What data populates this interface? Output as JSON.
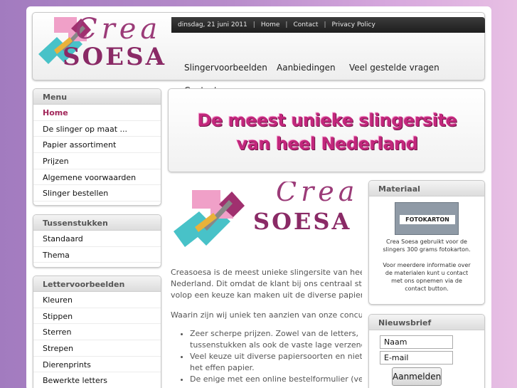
{
  "header": {
    "logo_top": "Crea",
    "logo_bottom": "SOESA",
    "date": "dinsdag, 21 juni 2011",
    "links": [
      "Home",
      "Contact",
      "Privacy Policy"
    ],
    "nav": [
      "Slingervoorbeelden",
      "Aanbiedingen",
      "Veel gestelde vragen",
      "Contact"
    ]
  },
  "banner": {
    "line1": "De meest unieke slingersite",
    "line2": "van heel Nederland"
  },
  "sidebar": {
    "menu": {
      "title": "Menu",
      "items": [
        "Home",
        "De slinger op maat ...",
        "Papier assortiment",
        "Prijzen",
        "Algemene voorwaarden",
        "Slinger bestellen"
      ],
      "active": "Home"
    },
    "tussenstukken": {
      "title": "Tussenstukken",
      "items": [
        "Standaard",
        "Thema"
      ]
    },
    "lettervoorbeelden": {
      "title": "Lettervoorbeelden",
      "items": [
        "Kleuren",
        "Stippen",
        "Sterren",
        "Strepen",
        "Dierenprints",
        "Bewerkte letters"
      ]
    }
  },
  "content": {
    "logo_top": "Crea",
    "logo_bottom": "SOESA",
    "para1_l1": "Creasoesa is de meest unieke slingersite van heel",
    "para1_l2": "Nederland. Dit omdat de klant bij ons centraal staat en",
    "para1_l3": "volop een keuze kan maken uit de diverse papiersoorten",
    "para2": "Waarin zijn wij uniek ten aanzien van onze concurrenten",
    "bullet1_l1": "Zeer scherpe prijzen. Zowel van de letters,",
    "bullet1_l2": "tussenstukken als ook de vaste lage verzendkosten",
    "bullet2_l1": "Veel keuze uit diverse papiersoorten en niet alleen",
    "bullet2_l2": "het effen papier.",
    "bullet3_l1": "De enige met een online bestelformulier (verwerkt"
  },
  "materiaal": {
    "title": "Materiaal",
    "product_label": "FOTOKARTON",
    "text_l1": "Crea Soesa gebruikt voor de",
    "text_l2": "slingers 300 grams fotokarton.",
    "text_l3": "Voor meerdere informatie over",
    "text_l4": "de materialen kunt u contact",
    "text_l5": "met ons opnemen via de",
    "text_l6": "contact button."
  },
  "nieuwsbrief": {
    "title": "Nieuwsbrief",
    "name_value": "Naam",
    "email_value": "E-mail",
    "submit": "Aanmelden"
  },
  "colors": {
    "accent": "#a2265a",
    "banner_pink": "#c2277c",
    "topbar": "#2a2a2a"
  }
}
